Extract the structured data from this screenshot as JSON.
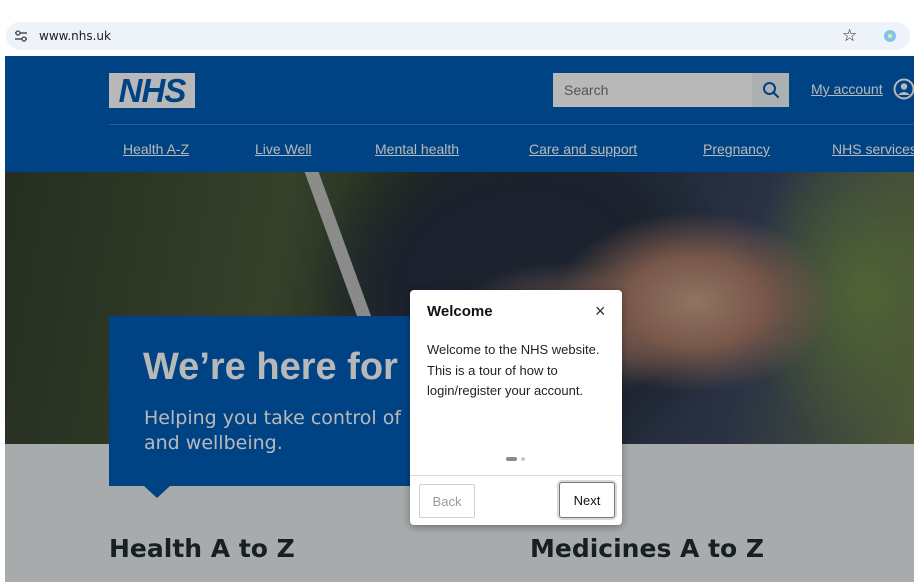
{
  "browser": {
    "url": "www.nhs.uk",
    "tune_icon": "site-settings-icon",
    "bookmark_icon": "star-icon",
    "extension_icon": "extension-icon"
  },
  "header": {
    "logo": "NHS",
    "search": {
      "placeholder": "Search",
      "icon": "search-icon"
    },
    "account_label": "My account",
    "account_icon": "user-circle-icon",
    "nav": [
      "Health A-Z",
      "Live Well",
      "Mental health",
      "Care and support",
      "Pregnancy",
      "NHS services"
    ]
  },
  "hero": {
    "title": "We’re here for",
    "subtitle": "Helping you take control of and wellbeing."
  },
  "sections": {
    "left": "Health A to Z",
    "right": "Medicines A to Z"
  },
  "tour_dialog": {
    "title": "Welcome",
    "close": "×",
    "body": "Welcome to the NHS website. This is a tour of how to login/register your account.",
    "step": 1,
    "steps_total": 2,
    "back_label": "Back",
    "next_label": "Next"
  },
  "colors": {
    "nhs_blue": "#005eb8",
    "page_bg": "#e8edee",
    "text_dark": "#212b32"
  }
}
